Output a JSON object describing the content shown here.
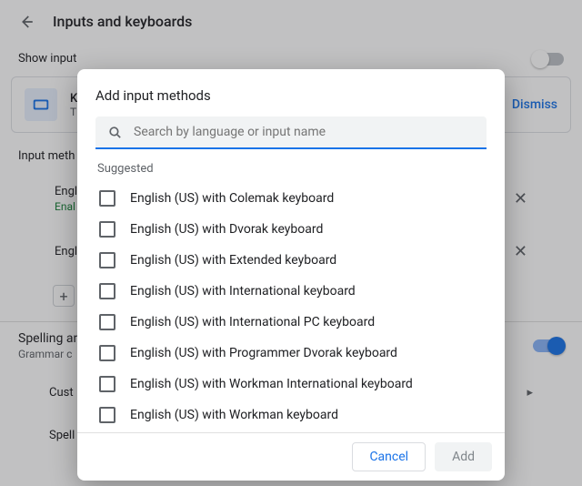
{
  "header": {
    "title": "Inputs and keyboards"
  },
  "show_row": {
    "label": "Show input"
  },
  "keyboard_card": {
    "title": "K",
    "sub": "T",
    "dismiss": "Dismiss"
  },
  "methods_label": "Input meth",
  "lang1": {
    "name": "Engl",
    "sub": "Enal"
  },
  "lang2": {
    "name": "Engl"
  },
  "spell": {
    "title": "Spelling an",
    "sub": "Grammar c"
  },
  "custom": {
    "label": "Cust"
  },
  "spellcheck": {
    "label": "Spell check languages"
  },
  "dialog": {
    "title": "Add input methods",
    "search_placeholder": "Search by language or input name",
    "suggested_label": "Suggested",
    "items": [
      "English (US) with Colemak keyboard",
      "English (US) with Dvorak keyboard",
      "English (US) with Extended keyboard",
      "English (US) with International keyboard",
      "English (US) with International PC keyboard",
      "English (US) with Programmer Dvorak keyboard",
      "English (US) with Workman International keyboard",
      "English (US) with Workman keyboard"
    ],
    "cancel": "Cancel",
    "add": "Add"
  }
}
